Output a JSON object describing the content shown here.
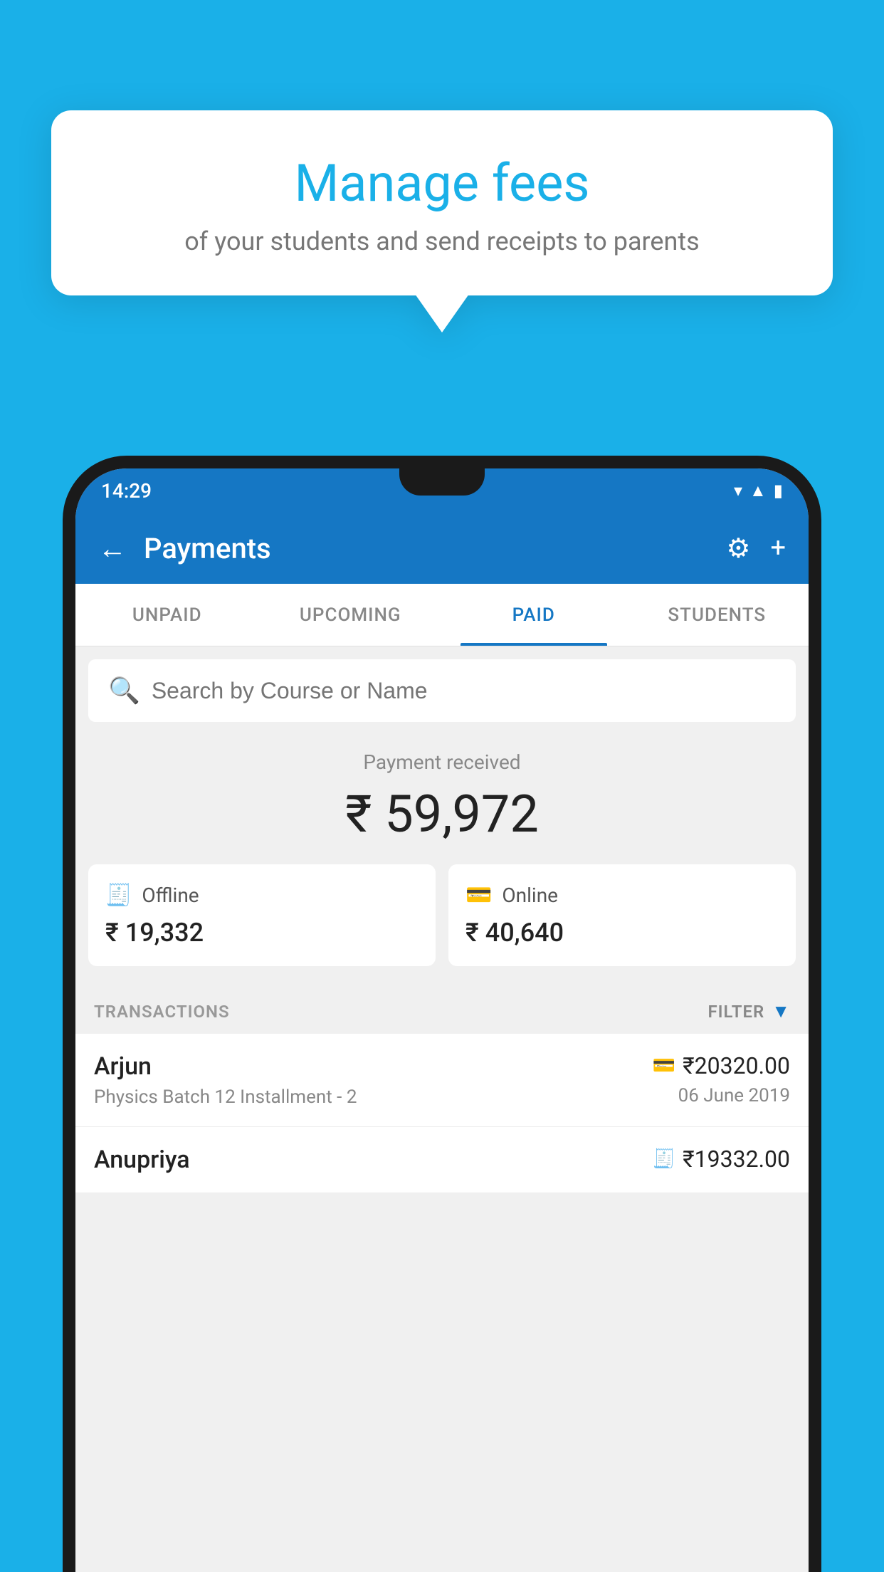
{
  "background_color": "#1ab0e8",
  "bubble": {
    "title": "Manage fees",
    "subtitle": "of your students and send receipts to parents"
  },
  "status_bar": {
    "time": "14:29"
  },
  "header": {
    "title": "Payments",
    "back_label": "←",
    "plus_label": "+"
  },
  "tabs": [
    {
      "label": "UNPAID",
      "active": false
    },
    {
      "label": "UPCOMING",
      "active": false
    },
    {
      "label": "PAID",
      "active": true
    },
    {
      "label": "STUDENTS",
      "active": false
    }
  ],
  "search": {
    "placeholder": "Search by Course or Name"
  },
  "payment_summary": {
    "label": "Payment received",
    "amount": "₹ 59,972"
  },
  "payment_cards": [
    {
      "id": "offline",
      "label": "Offline",
      "amount": "₹ 19,332",
      "icon": "🧾"
    },
    {
      "id": "online",
      "label": "Online",
      "amount": "₹ 40,640",
      "icon": "💳"
    }
  ],
  "transactions_label": "TRANSACTIONS",
  "filter_label": "FILTER",
  "transactions": [
    {
      "name": "Arjun",
      "detail": "Physics Batch 12 Installment - 2",
      "amount": "₹20320.00",
      "date": "06 June 2019",
      "mode": "online"
    },
    {
      "name": "Anupriya",
      "detail": "",
      "amount": "₹19332.00",
      "date": "",
      "mode": "offline"
    }
  ]
}
